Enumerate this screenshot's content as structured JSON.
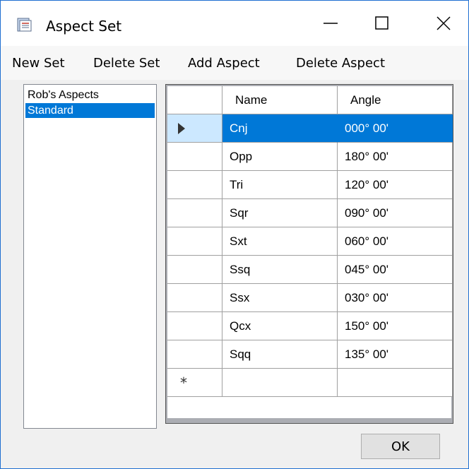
{
  "window": {
    "title": "Aspect Set"
  },
  "menu": [
    {
      "label": "New Set"
    },
    {
      "label": "Delete Set"
    },
    {
      "label": "Add Aspect"
    },
    {
      "label": "Delete Aspect"
    }
  ],
  "sets": [
    {
      "label": "Rob's Aspects",
      "selected": false
    },
    {
      "label": "Standard",
      "selected": true
    }
  ],
  "grid": {
    "columns": [
      "Name",
      "Angle"
    ],
    "rows": [
      {
        "name": "Cnj",
        "angle": "000° 00'"
      },
      {
        "name": "Opp",
        "angle": "180° 00'"
      },
      {
        "name": "Tri",
        "angle": "120° 00'"
      },
      {
        "name": "Sqr",
        "angle": "090° 00'"
      },
      {
        "name": "Sxt",
        "angle": "060° 00'"
      },
      {
        "name": "Ssq",
        "angle": "045° 00'"
      },
      {
        "name": "Ssx",
        "angle": "030° 00'"
      },
      {
        "name": "Qcx",
        "angle": "150° 00'"
      },
      {
        "name": "Sqq",
        "angle": "135° 00'"
      }
    ],
    "new_row_marker": "*"
  },
  "buttons": {
    "ok": "OK"
  },
  "colors": {
    "selection": "#0078d7",
    "current_row_header": "#cce8ff",
    "window_border": "#1f6fd1"
  }
}
